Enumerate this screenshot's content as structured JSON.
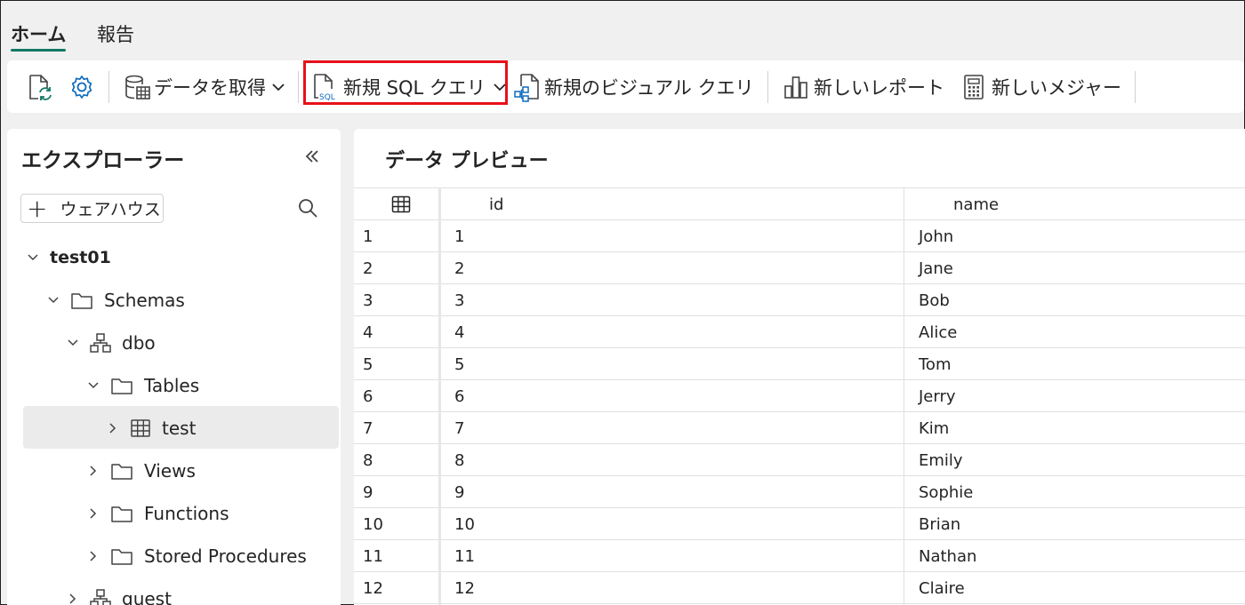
{
  "tabs": {
    "home": "ホーム",
    "report": "報告"
  },
  "ribbon": {
    "get_data": "データを取得",
    "new_sql_query": "新規 SQL クエリ",
    "new_visual_query": "新規のビジュアル クエリ",
    "new_report": "新しいレポート",
    "new_measure": "新しいメジャー"
  },
  "explorer": {
    "title": "エクスプローラー",
    "add_warehouse": "ウェアハウス",
    "tree": {
      "db": "test01",
      "schemas": "Schemas",
      "dbo": "dbo",
      "tables": "Tables",
      "test": "test",
      "views": "Views",
      "functions": "Functions",
      "stored_procedures": "Stored Procedures",
      "guest": "guest"
    }
  },
  "preview": {
    "title": "データ プレビュー",
    "columns": [
      "id",
      "name"
    ],
    "rows": [
      {
        "n": "1",
        "id": "1",
        "name": "John"
      },
      {
        "n": "2",
        "id": "2",
        "name": "Jane"
      },
      {
        "n": "3",
        "id": "3",
        "name": "Bob"
      },
      {
        "n": "4",
        "id": "4",
        "name": "Alice"
      },
      {
        "n": "5",
        "id": "5",
        "name": "Tom"
      },
      {
        "n": "6",
        "id": "6",
        "name": "Jerry"
      },
      {
        "n": "7",
        "id": "7",
        "name": "Kim"
      },
      {
        "n": "8",
        "id": "8",
        "name": "Emily"
      },
      {
        "n": "9",
        "id": "9",
        "name": "Sophie"
      },
      {
        "n": "10",
        "id": "10",
        "name": "Brian"
      },
      {
        "n": "11",
        "id": "11",
        "name": "Nathan"
      },
      {
        "n": "12",
        "id": "12",
        "name": "Claire"
      }
    ]
  },
  "colors": {
    "accent": "#117865",
    "highlight_box": "#e8101a",
    "icon_blue": "#0f6cbd"
  }
}
